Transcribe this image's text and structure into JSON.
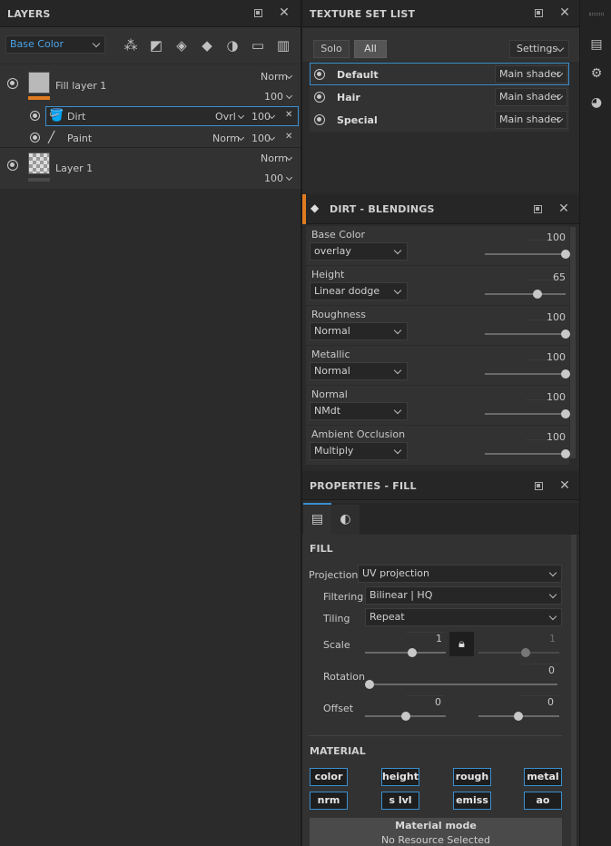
{
  "layers": {
    "title": "LAYERS",
    "channel_select": "Base Color",
    "items": [
      {
        "name": "Fill layer 1",
        "blend": "Norm",
        "opacity": "100"
      },
      {
        "name": "Dirt",
        "blend": "Ovrl",
        "opacity": "100"
      },
      {
        "name": "Paint",
        "blend": "Norm",
        "opacity": "100"
      },
      {
        "name": "Layer 1",
        "blend": "Norm",
        "opacity": "100"
      }
    ]
  },
  "texture_set": {
    "title": "TEXTURE SET LIST",
    "solo": "Solo",
    "all": "All",
    "settings": "Settings",
    "items": [
      {
        "name": "Default",
        "shader": "Main shader"
      },
      {
        "name": "Hair",
        "shader": "Main shader"
      },
      {
        "name": "Special",
        "shader": "Main shader"
      }
    ]
  },
  "blendings": {
    "title": "DIRT - BLENDINGS",
    "channels": [
      {
        "label": "Base Color",
        "mode": "overlay",
        "value": "100",
        "level": 1.0
      },
      {
        "label": "Height",
        "mode": "Linear dodge",
        "value": "65",
        "level": 0.65
      },
      {
        "label": "Roughness",
        "mode": "Normal",
        "value": "100",
        "level": 1.0
      },
      {
        "label": "Metallic",
        "mode": "Normal",
        "value": "100",
        "level": 1.0
      },
      {
        "label": "Normal",
        "mode": "NMdt",
        "value": "100",
        "level": 1.0
      },
      {
        "label": "Ambient Occlusion",
        "mode": "Multiply",
        "value": "100",
        "level": 1.0
      }
    ]
  },
  "properties": {
    "title": "PROPERTIES - FILL",
    "fill_heading": "FILL",
    "projection_label": "Projection",
    "projection_value": "UV projection",
    "filtering_label": "Filtering",
    "filtering_value": "Bilinear | HQ",
    "tiling_label": "Tiling",
    "tiling_value": "Repeat",
    "scale_label": "Scale",
    "scale_u": "1",
    "scale_v": "1",
    "rotation_label": "Rotation",
    "rotation_value": "0",
    "offset_label": "Offset",
    "offset_u": "0",
    "offset_v": "0",
    "material_heading": "MATERIAL",
    "material_chips": [
      "color",
      "height",
      "rough",
      "metal",
      "nrm",
      "s lvl",
      "emiss",
      "ao"
    ],
    "material_mode_title": "Material mode",
    "material_mode_sub": "No Resource Selected"
  },
  "colors": {
    "accent": "#e07b20",
    "selection": "#3a8fd0"
  }
}
